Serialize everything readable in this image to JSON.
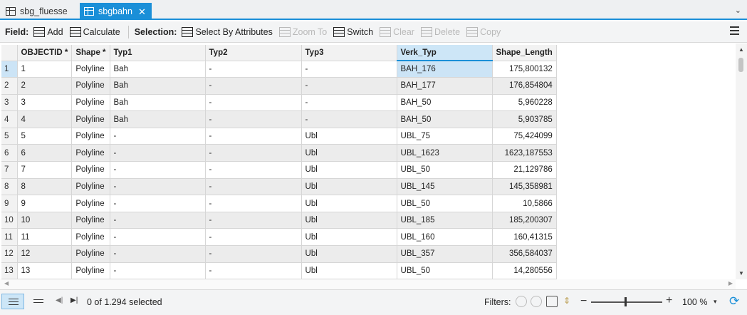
{
  "tabs": [
    {
      "label": "sbg_fluesse",
      "active": false
    },
    {
      "label": "sbgbahn",
      "active": true,
      "close": "✕"
    }
  ],
  "toolbar": {
    "field_label": "Field:",
    "add": "Add",
    "calculate": "Calculate",
    "selection_label": "Selection:",
    "select_by_attributes": "Select By Attributes",
    "zoom_to": "Zoom To",
    "switch": "Switch",
    "clear": "Clear",
    "delete": "Delete",
    "copy": "Copy"
  },
  "columns": [
    "OBJECTID *",
    "Shape *",
    "Typ1",
    "Typ2",
    "Typ3",
    "Verk_Typ",
    "Shape_Length"
  ],
  "rows": [
    {
      "n": "1",
      "id": "1",
      "shape": "Polyline",
      "typ1": "Bah",
      "typ2": "-",
      "typ3": "-",
      "verk": "BAH_176",
      "len": "175,800132"
    },
    {
      "n": "2",
      "id": "2",
      "shape": "Polyline",
      "typ1": "Bah",
      "typ2": "-",
      "typ3": "-",
      "verk": "BAH_177",
      "len": "176,854804"
    },
    {
      "n": "3",
      "id": "3",
      "shape": "Polyline",
      "typ1": "Bah",
      "typ2": "-",
      "typ3": "-",
      "verk": "BAH_50",
      "len": "5,960228"
    },
    {
      "n": "4",
      "id": "4",
      "shape": "Polyline",
      "typ1": "Bah",
      "typ2": "-",
      "typ3": "-",
      "verk": "BAH_50",
      "len": "5,903785"
    },
    {
      "n": "5",
      "id": "5",
      "shape": "Polyline",
      "typ1": "-",
      "typ2": "-",
      "typ3": "Ubl",
      "verk": "UBL_75",
      "len": "75,424099"
    },
    {
      "n": "6",
      "id": "6",
      "shape": "Polyline",
      "typ1": "-",
      "typ2": "-",
      "typ3": "Ubl",
      "verk": "UBL_1623",
      "len": "1623,187553"
    },
    {
      "n": "7",
      "id": "7",
      "shape": "Polyline",
      "typ1": "-",
      "typ2": "-",
      "typ3": "Ubl",
      "verk": "UBL_50",
      "len": "21,129786"
    },
    {
      "n": "8",
      "id": "8",
      "shape": "Polyline",
      "typ1": "-",
      "typ2": "-",
      "typ3": "Ubl",
      "verk": "UBL_145",
      "len": "145,358981"
    },
    {
      "n": "9",
      "id": "9",
      "shape": "Polyline",
      "typ1": "-",
      "typ2": "-",
      "typ3": "Ubl",
      "verk": "UBL_50",
      "len": "10,5866"
    },
    {
      "n": "10",
      "id": "10",
      "shape": "Polyline",
      "typ1": "-",
      "typ2": "-",
      "typ3": "Ubl",
      "verk": "UBL_185",
      "len": "185,200307"
    },
    {
      "n": "11",
      "id": "11",
      "shape": "Polyline",
      "typ1": "-",
      "typ2": "-",
      "typ3": "Ubl",
      "verk": "UBL_160",
      "len": "160,41315"
    },
    {
      "n": "12",
      "id": "12",
      "shape": "Polyline",
      "typ1": "-",
      "typ2": "-",
      "typ3": "Ubl",
      "verk": "UBL_357",
      "len": "356,584037"
    },
    {
      "n": "13",
      "id": "13",
      "shape": "Polyline",
      "typ1": "-",
      "typ2": "-",
      "typ3": "Ubl",
      "verk": "UBL_50",
      "len": "14,280556"
    }
  ],
  "status": {
    "selected_text": "0 of 1.294 selected",
    "filters_label": "Filters:",
    "zoom_value": "100 %",
    "zoom_level": 1.0
  },
  "colors": {
    "accent": "#1a8fd8",
    "selected_cell": "#cce4f6"
  },
  "icons": [
    "table-icon",
    "close-icon",
    "add-field-icon",
    "calculate-icon",
    "select-by-attributes-icon",
    "zoom-to-icon",
    "switch-icon",
    "clear-icon",
    "delete-icon",
    "copy-icon",
    "menu-icon",
    "refresh-icon"
  ]
}
